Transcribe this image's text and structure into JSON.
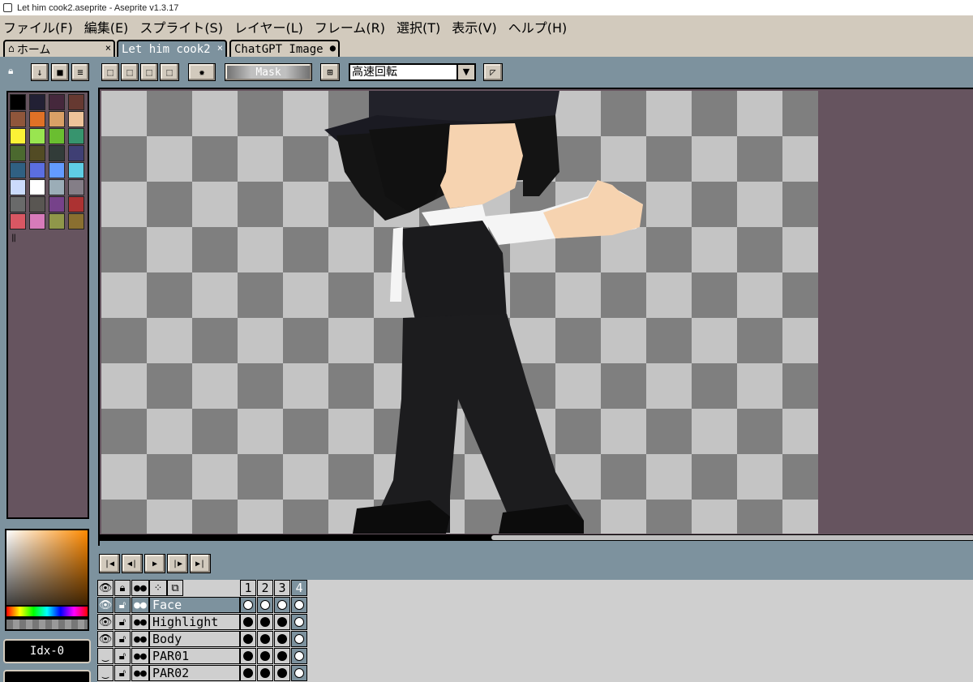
{
  "window": {
    "title": "Let him cook2.aseprite - Aseprite v1.3.17"
  },
  "menu": [
    "ファイル(F)",
    "編集(E)",
    "スプライト(S)",
    "レイヤー(L)",
    "フレーム(R)",
    "選択(T)",
    "表示(V)",
    "ヘルプ(H)"
  ],
  "tabs": [
    {
      "label": "ホーム",
      "close": "×",
      "active": false
    },
    {
      "label": "Let him cook2",
      "close": "×",
      "active": true
    },
    {
      "label": "ChatGPT Image",
      "close": "●",
      "active": false
    }
  ],
  "toolbar": {
    "mask_label": "Mask",
    "rotation_algorithm": "高速回転"
  },
  "colors": {
    "panel_bg": "#7d929e",
    "menu_bg": "#d2cabd",
    "palette_bg": "#66545f"
  },
  "palette": [
    "#000000",
    "#222034",
    "#45283c",
    "#663931",
    "#8f563b",
    "#df7126",
    "#d9a066",
    "#eec39a",
    "#fbf236",
    "#99e550",
    "#6abe30",
    "#37946e",
    "#4b692f",
    "#524b24",
    "#323c39",
    "#3f3f74",
    "#306082",
    "#5b6ee1",
    "#639bff",
    "#5fcde4",
    "#cbdbfc",
    "#ffffff",
    "#9badb7",
    "#847e87",
    "#696a6a",
    "#595652",
    "#76428a",
    "#ac3232",
    "#d95763",
    "#d77bba",
    "#8f974a",
    "#8a6f30"
  ],
  "color_status": {
    "index_label": "Idx-0"
  },
  "timeline": {
    "frames": [
      "1",
      "2",
      "3",
      "4"
    ],
    "active_frame": "4",
    "layers": [
      {
        "name": "Face",
        "visible": true,
        "selected": true,
        "cels": [
          "empty",
          "empty",
          "empty",
          "empty"
        ]
      },
      {
        "name": "Highlight",
        "visible": true,
        "selected": false,
        "cels": [
          "filled",
          "filled",
          "filled",
          "empty"
        ]
      },
      {
        "name": "Body",
        "visible": true,
        "selected": false,
        "cels": [
          "filled",
          "filled",
          "filled",
          "empty"
        ]
      },
      {
        "name": "PAR01",
        "visible": false,
        "selected": false,
        "cels": [
          "filled",
          "filled",
          "filled",
          "empty"
        ]
      },
      {
        "name": "PAR02",
        "visible": false,
        "selected": false,
        "cels": [
          "filled",
          "filled",
          "filled",
          "empty"
        ]
      }
    ]
  }
}
